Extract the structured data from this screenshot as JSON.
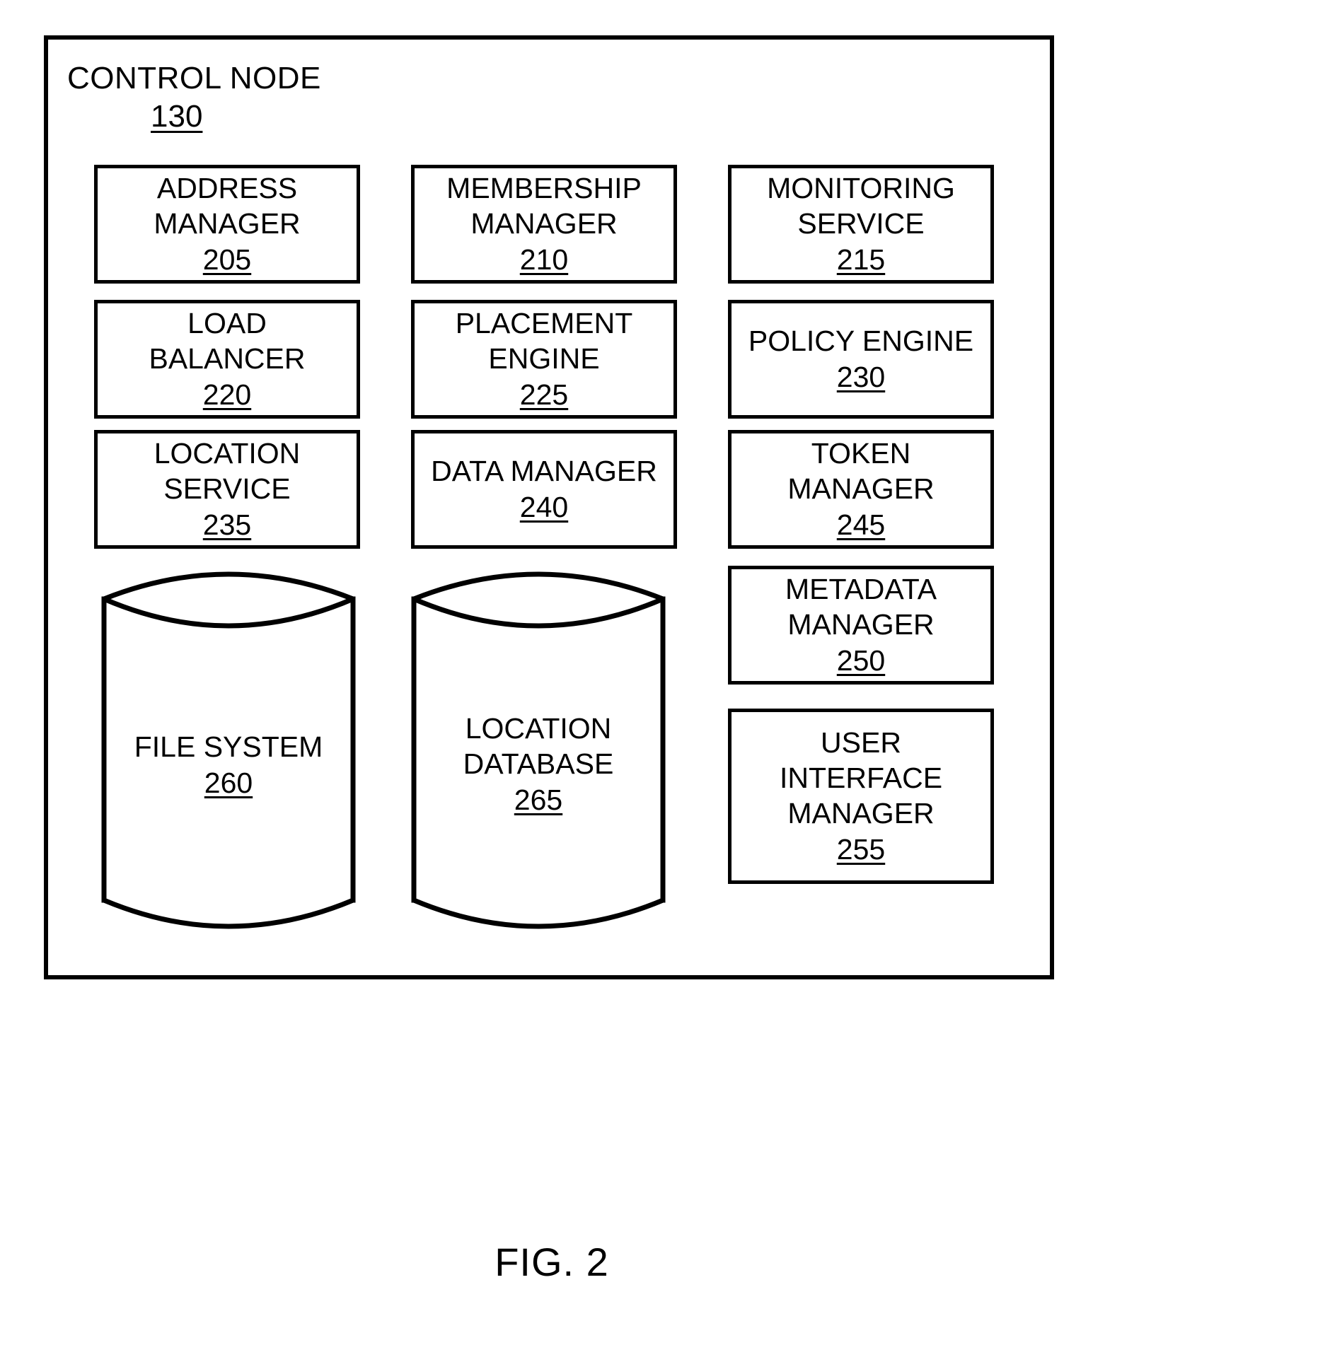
{
  "figure": {
    "caption": "FIG. 2",
    "title_label": "CONTROL NODE",
    "title_ref": "130"
  },
  "components": [
    {
      "name": "address-manager",
      "lines": [
        "ADDRESS",
        "MANAGER"
      ],
      "ref": "205",
      "shape": "box",
      "column": 1,
      "row": 1
    },
    {
      "name": "membership-manager",
      "lines": [
        "MEMBERSHIP",
        "MANAGER"
      ],
      "ref": "210",
      "shape": "box",
      "column": 2,
      "row": 1
    },
    {
      "name": "monitoring-service",
      "lines": [
        "MONITORING",
        "SERVICE"
      ],
      "ref": "215",
      "shape": "box",
      "column": 3,
      "row": 1
    },
    {
      "name": "load-balancer",
      "lines": [
        "LOAD",
        "BALANCER"
      ],
      "ref": "220",
      "shape": "box",
      "column": 1,
      "row": 2
    },
    {
      "name": "placement-engine",
      "lines": [
        "PLACEMENT",
        "ENGINE"
      ],
      "ref": "225",
      "shape": "box",
      "column": 2,
      "row": 2
    },
    {
      "name": "policy-engine",
      "lines": [
        "POLICY ENGINE"
      ],
      "ref": "230",
      "shape": "box",
      "column": 3,
      "row": 2
    },
    {
      "name": "location-service",
      "lines": [
        "LOCATION",
        "SERVICE"
      ],
      "ref": "235",
      "shape": "box",
      "column": 1,
      "row": 3
    },
    {
      "name": "data-manager",
      "lines": [
        "DATA MANAGER"
      ],
      "ref": "240",
      "shape": "box",
      "column": 2,
      "row": 3
    },
    {
      "name": "token-manager",
      "lines": [
        "TOKEN",
        "MANAGER"
      ],
      "ref": "245",
      "shape": "box",
      "column": 3,
      "row": 3
    },
    {
      "name": "metadata-manager",
      "lines": [
        "METADATA",
        "MANAGER"
      ],
      "ref": "250",
      "shape": "box",
      "column": 3,
      "row": 4
    },
    {
      "name": "user-interface-manager",
      "lines": [
        "USER",
        "INTERFACE",
        "MANAGER"
      ],
      "ref": "255",
      "shape": "box",
      "column": 3,
      "row": 5
    },
    {
      "name": "file-system",
      "lines": [
        "FILE SYSTEM"
      ],
      "ref": "260",
      "shape": "cylinder",
      "column": 1,
      "row": 4
    },
    {
      "name": "location-database",
      "lines": [
        "LOCATION",
        "DATABASE"
      ],
      "ref": "265",
      "shape": "cylinder",
      "column": 2,
      "row": 4
    }
  ],
  "boxes": {
    "address_manager": {
      "l1": "ADDRESS",
      "l2": "MANAGER",
      "ref": "205"
    },
    "membership_manager": {
      "l1": "MEMBERSHIP",
      "l2": "MANAGER",
      "ref": "210"
    },
    "monitoring_service": {
      "l1": "MONITORING",
      "l2": "SERVICE",
      "ref": "215"
    },
    "load_balancer": {
      "l1": "LOAD",
      "l2": "BALANCER",
      "ref": "220"
    },
    "placement_engine": {
      "l1": "PLACEMENT",
      "l2": "ENGINE",
      "ref": "225"
    },
    "policy_engine": {
      "l1": "POLICY ENGINE",
      "ref": "230"
    },
    "location_service": {
      "l1": "LOCATION",
      "l2": "SERVICE",
      "ref": "235"
    },
    "data_manager": {
      "l1": "DATA MANAGER",
      "ref": "240"
    },
    "token_manager": {
      "l1": "TOKEN",
      "l2": "MANAGER",
      "ref": "245"
    },
    "metadata_manager": {
      "l1": "METADATA",
      "l2": "MANAGER",
      "ref": "250"
    },
    "user_interface_manager": {
      "l1": "USER",
      "l2": "INTERFACE",
      "l3": "MANAGER",
      "ref": "255"
    },
    "file_system": {
      "l1": "FILE SYSTEM",
      "ref": "260"
    },
    "location_database": {
      "l1": "LOCATION",
      "l2": "DATABASE",
      "ref": "265"
    }
  },
  "colors": {
    "stroke": "#000000",
    "fill": "#ffffff",
    "text": "#000000"
  }
}
